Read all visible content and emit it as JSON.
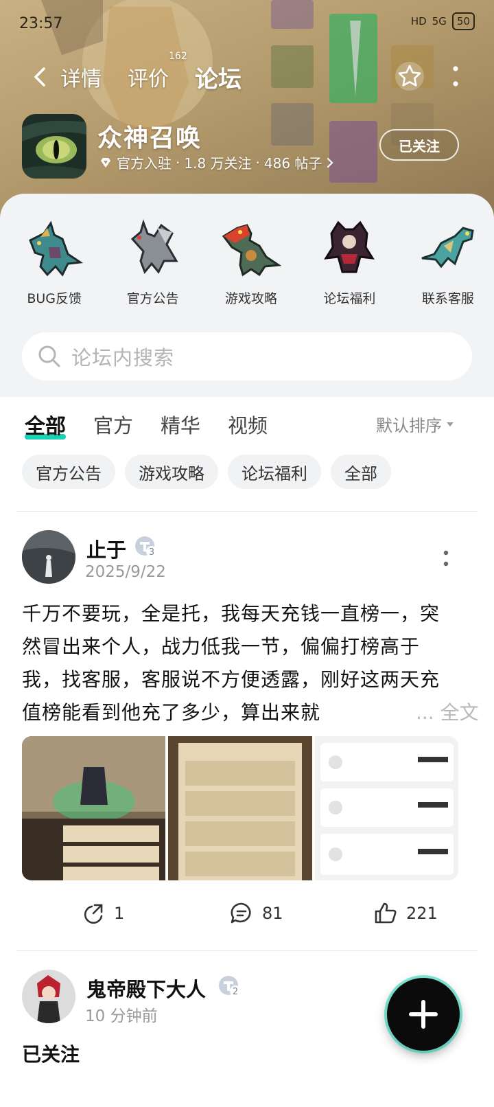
{
  "status_bar": {
    "time": "23:57",
    "hd": "HD",
    "signal": "5G",
    "battery": "50"
  },
  "header": {
    "tabs": [
      {
        "label": "详情",
        "badge": ""
      },
      {
        "label": "评价",
        "badge": "162"
      },
      {
        "label": "论坛",
        "badge": ""
      }
    ],
    "active_tab": "论坛"
  },
  "app": {
    "name": "众神召唤",
    "official": "官方入驻",
    "followers": "1.8 万关注",
    "posts": "486 帖子",
    "separator": "·",
    "follow_button": "已关注"
  },
  "categories": [
    {
      "label": "BUG反馈"
    },
    {
      "label": "官方公告"
    },
    {
      "label": "游戏攻略"
    },
    {
      "label": "论坛福利"
    },
    {
      "label": "联系客服"
    }
  ],
  "search": {
    "placeholder": "论坛内搜索"
  },
  "content_tabs": [
    "全部",
    "官方",
    "精华",
    "视频"
  ],
  "sort": {
    "label": "默认排序"
  },
  "filters": [
    "官方公告",
    "游戏攻略",
    "论坛福利",
    "全部"
  ],
  "posts": [
    {
      "author": "止于",
      "level": "3",
      "time": "2025/9/22",
      "body": "千万不要玩，全是托，我每天充钱一直榜一，突然冒出来个人，战力低我一节，偏偏打榜高于我，找客服，客服说不方便透露，刚好这两天充值榜能看到他充了多少，算出来就",
      "more": "... 全文",
      "shares": "1",
      "comments": "81",
      "likes": "221"
    },
    {
      "author": "鬼帝殿下大人",
      "level": "2",
      "time": "10 分钟前",
      "body": "已关注"
    }
  ],
  "colors": {
    "accent": "#19d1b3",
    "hero": "#b39a6c"
  },
  "icons": [
    "back-icon",
    "star-icon",
    "more-vertical-icon",
    "diamond-icon",
    "chevron-right-icon",
    "search-icon",
    "caret-down-icon",
    "share-icon",
    "comment-icon",
    "like-icon",
    "plus-icon"
  ]
}
